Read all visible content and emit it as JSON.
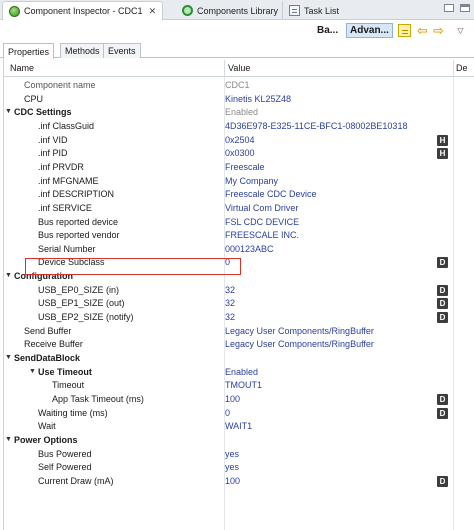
{
  "tabs": {
    "component_inspector": "Component Inspector - CDC1",
    "components_library": "Components Library",
    "task_list": "Task List",
    "close_glyph": "✕"
  },
  "toolbar": {
    "basic_label": "Ba...",
    "advanced_label": "Advan...",
    "menu_glyph": "▽"
  },
  "property_tabs": [
    "Properties",
    "Methods",
    "Events"
  ],
  "table": {
    "col_name": "Name",
    "col_value": "Value",
    "col_details": "De",
    "rows": [
      {
        "name": "Component name",
        "value": "CDC1",
        "indent": 1,
        "name_style": "gray",
        "value_style": "gray"
      },
      {
        "name": "CPU",
        "value": "Kinetis KL25Z48",
        "indent": 1,
        "name_style": "normal",
        "value_style": "blue"
      },
      {
        "name": "CDC Settings",
        "value": "Enabled",
        "indent": 0,
        "name_style": "bold",
        "value_style": "gray",
        "expander": "expanded"
      },
      {
        "name": ".inf ClassGuid",
        "value": "4D36E978-E325-11CE-BFC1-08002BE10318",
        "indent": 2,
        "name_style": "normal",
        "value_style": "blue"
      },
      {
        "name": ".inf VID",
        "value": "0x2504",
        "indent": 2,
        "name_style": "normal",
        "value_style": "blue",
        "badge": "H"
      },
      {
        "name": ".inf PID",
        "value": "0x0300",
        "indent": 2,
        "name_style": "normal",
        "value_style": "blue",
        "badge": "H"
      },
      {
        "name": ".inf PRVDR",
        "value": "Freescale",
        "indent": 2,
        "name_style": "normal",
        "value_style": "blue"
      },
      {
        "name": ".inf MFGNAME",
        "value": "My Company",
        "indent": 2,
        "name_style": "normal",
        "value_style": "blue"
      },
      {
        "name": ".inf DESCRIPTION",
        "value": "Freescale CDC Device",
        "indent": 2,
        "name_style": "normal",
        "value_style": "blue"
      },
      {
        "name": ".inf SERVICE",
        "value": "Virtual Com Driver",
        "indent": 2,
        "name_style": "normal",
        "value_style": "blue"
      },
      {
        "name": "Bus reported device",
        "value": "FSL CDC DEVICE",
        "indent": 2,
        "name_style": "normal",
        "value_style": "blue"
      },
      {
        "name": "Bus reported vendor",
        "value": "FREESCALE INC.",
        "indent": 2,
        "name_style": "normal",
        "value_style": "blue"
      },
      {
        "name": "Serial Number",
        "value": "000123ABC",
        "indent": 2,
        "name_style": "normal",
        "value_style": "blue"
      },
      {
        "name": "Device Subclass",
        "value": "0",
        "indent": 2,
        "name_style": "normal",
        "value_style": "blue",
        "badge": "D"
      },
      {
        "name": "Configuration",
        "value": "",
        "indent": 0,
        "name_style": "bold",
        "value_style": "blue",
        "expander": "expanded"
      },
      {
        "name": "USB_EP0_SIZE (in)",
        "value": "32",
        "indent": 2,
        "name_style": "normal",
        "value_style": "blue",
        "badge": "D"
      },
      {
        "name": "USB_EP1_SIZE (out)",
        "value": "32",
        "indent": 2,
        "name_style": "normal",
        "value_style": "blue",
        "badge": "D"
      },
      {
        "name": "USB_EP2_SIZE (notify)",
        "value": "32",
        "indent": 2,
        "name_style": "normal",
        "value_style": "blue",
        "badge": "D"
      },
      {
        "name": "Send Buffer",
        "value": "Legacy User Components/RingBuffer",
        "indent": 1,
        "name_style": "normal",
        "value_style": "blue"
      },
      {
        "name": "Receive Buffer",
        "value": "Legacy User Components/RingBuffer",
        "indent": 1,
        "name_style": "normal",
        "value_style": "blue"
      },
      {
        "name": "SendDataBlock",
        "value": "",
        "indent": 0,
        "name_style": "bold",
        "value_style": "blue",
        "expander": "expanded"
      },
      {
        "name": "Use Timeout",
        "value": "Enabled",
        "indent": 2,
        "name_style": "bold",
        "value_style": "blue",
        "expander": "expanded"
      },
      {
        "name": "Timeout",
        "value": "TMOUT1",
        "indent": 3,
        "name_style": "normal",
        "value_style": "blue"
      },
      {
        "name": "App Task Timeout (ms)",
        "value": "100",
        "indent": 3,
        "name_style": "normal",
        "value_style": "blue",
        "badge": "D"
      },
      {
        "name": "Waiting time (ms)",
        "value": "0",
        "indent": 2,
        "name_style": "normal",
        "value_style": "blue",
        "badge": "D"
      },
      {
        "name": "Wait",
        "value": "WAIT1",
        "indent": 2,
        "name_style": "normal",
        "value_style": "blue"
      },
      {
        "name": "Power Options",
        "value": "",
        "indent": 0,
        "name_style": "bold",
        "value_style": "blue",
        "expander": "expanded"
      },
      {
        "name": "Bus Powered",
        "value": "yes",
        "indent": 2,
        "name_style": "normal",
        "value_style": "blue"
      },
      {
        "name": "Self Powered",
        "value": "yes",
        "indent": 2,
        "name_style": "normal",
        "value_style": "blue"
      },
      {
        "name": "Current Draw (mA)",
        "value": "100",
        "indent": 2,
        "name_style": "normal",
        "value_style": "blue",
        "badge": "D"
      }
    ]
  },
  "colors": {
    "value_text": "#2a3f9e",
    "highlight_box": "#d9322b",
    "badge_bg": "#3d3d3d"
  },
  "icons": {
    "component_inspector_tab": "green-gear-icon",
    "components_library_tab": "library-icon",
    "task_list_tab": "task-list-icon",
    "notes": "sticky-note-icon",
    "back": "arrow-left-icon",
    "forward": "arrow-right-icon",
    "view_menu": "view-menu-icon"
  }
}
